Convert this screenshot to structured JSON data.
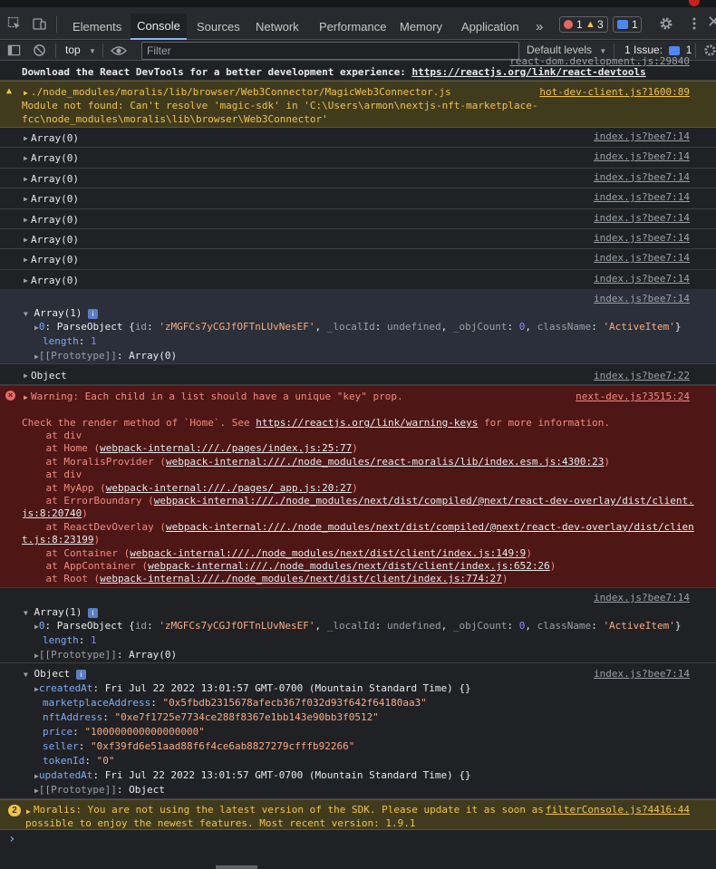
{
  "tabs": [
    "Elements",
    "Console",
    "Sources",
    "Network",
    "Performance",
    "Memory",
    "Application"
  ],
  "tabs_more": "»",
  "badges": {
    "errors": "1",
    "warnings": "3",
    "messages": "1",
    "issues_label": "1 Issue:",
    "issues_count": "1"
  },
  "toolbar": {
    "context": "top",
    "filter_placeholder": "Filter",
    "levels": "Default levels"
  },
  "prev_line": "react-dom.development.js:29840",
  "devtools_msg": "Download the React DevTools for a better development experience: ",
  "devtools_link": "https://reactjs.org/link/react-devtools",
  "warn1": {
    "lines": [
      "./node_modules/moralis/lib/browser/Web3Connector/MagicWeb3Connector.js",
      "Module not found: Can't resolve 'magic-sdk' in 'C:\\Users\\armon\\nextjs-nft-marketplace-",
      "fcc\\node_modules\\moralis\\lib\\browser\\Web3Connector'"
    ],
    "src": "hot-dev-client.js?1600:89"
  },
  "array0_rows": [
    "Array(0)",
    "Array(0)",
    "Array(0)",
    "Array(0)",
    "Array(0)",
    "Array(0)",
    "Array(0)",
    "Array(0)"
  ],
  "src_index14": "index.js?bee7:14",
  "src_index22": "index.js?bee7:22",
  "array1": {
    "head": "Array(1)",
    "item_key": "0",
    "item_type": "ParseObject",
    "item_id_key": "id",
    "item_id_val": "'zMGFCs7yCGJfOFTnLUvNesEF'",
    "localid_key": "_localId",
    "localid_val": "undefined",
    "objcount_key": "_objCount",
    "objcount_val": "0",
    "classname_key": "className",
    "classname_val": "'ActiveItem'",
    "length_key": "length",
    "length_val": "1",
    "proto_key": "[[Prototype]]",
    "proto_val": "Array(0)"
  },
  "object_collapsed": "Object",
  "error": {
    "head": "Warning: Each child in a list should have a unique \"key\" prop.",
    "src": "next-dev.js?3515:24",
    "check_pre": "Check the render method of `Home`. See ",
    "check_link": "https://reactjs.org/link/warning-keys",
    "check_post": " for more information.",
    "stack": [
      {
        "pre": "    at div",
        "link": "",
        "post": ""
      },
      {
        "pre": "    at Home (",
        "link": "webpack-internal:///./pages/index.js:25:77",
        "post": ")"
      },
      {
        "pre": "    at MoralisProvider (",
        "link": "webpack-internal:///./node_modules/react-moralis/lib/index.esm.js:4300:23",
        "post": ")"
      },
      {
        "pre": "    at div",
        "link": "",
        "post": ""
      },
      {
        "pre": "    at MyApp (",
        "link": "webpack-internal:///./pages/_app.js:20:27",
        "post": ")"
      },
      {
        "pre": "    at ErrorBoundary (",
        "link": "webpack-internal:///./node_modules/next/dist/compiled/@next/react-dev-overlay/dist/client.",
        "post": ""
      },
      {
        "pre": "",
        "link": "js:8:20740",
        "post": ")"
      },
      {
        "pre": "    at ReactDevOverlay (",
        "link": "webpack-internal:///./node_modules/next/dist/compiled/@next/react-dev-overlay/dist/clien",
        "post": ""
      },
      {
        "pre": "",
        "link": "t.js:8:23199",
        "post": ")"
      },
      {
        "pre": "    at Container (",
        "link": "webpack-internal:///./node_modules/next/dist/client/index.js:149:9",
        "post": ")"
      },
      {
        "pre": "    at AppContainer (",
        "link": "webpack-internal:///./node_modules/next/dist/client/index.js:652:26",
        "post": ")"
      },
      {
        "pre": "    at Root (",
        "link": "webpack-internal:///./node_modules/next/dist/client/index.js:774:27",
        "post": ")"
      }
    ]
  },
  "object_expanded": {
    "head": "Object",
    "props": [
      {
        "key": "createdAt",
        "val": "Fri Jul 22 2022 13:01:57 GMT-0700 (Mountain Standard Time) {}",
        "kind": "plain",
        "arrow": true
      },
      {
        "key": "marketplaceAddress",
        "val": "\"0x5fbdb2315678afecb367f032d93f642f64180aa3\"",
        "kind": "str",
        "arrow": false
      },
      {
        "key": "nftAddress",
        "val": "\"0xe7f1725e7734ce288f8367e1bb143e90bb3f0512\"",
        "kind": "str",
        "arrow": false
      },
      {
        "key": "price",
        "val": "\"100000000000000000\"",
        "kind": "str",
        "arrow": false
      },
      {
        "key": "seller",
        "val": "\"0xf39fd6e51aad88f6f4ce6ab8827279cfffb92266\"",
        "kind": "str",
        "arrow": false
      },
      {
        "key": "tokenId",
        "val": "\"0\"",
        "kind": "str",
        "arrow": false
      },
      {
        "key": "updatedAt",
        "val": "Fri Jul 22 2022 13:01:57 GMT-0700 (Mountain Standard Time) {}",
        "kind": "plain",
        "arrow": true
      },
      {
        "key": "[[Prototype]]",
        "val": "Object",
        "kind": "plain",
        "arrow": true
      }
    ]
  },
  "warn2": {
    "count": "2",
    "line1": "Moralis: You are not using the latest version of the SDK. Please update it as soon as ",
    "line2": "possible to enjoy the newest features. Most recent version: 1.9.1",
    "src": "filterConsole.js?4416:44"
  },
  "prompt": "›",
  "colors": {
    "accent": "#8ab4f8",
    "warning_bg": "#413b1e",
    "error_bg": "#4e1615"
  }
}
